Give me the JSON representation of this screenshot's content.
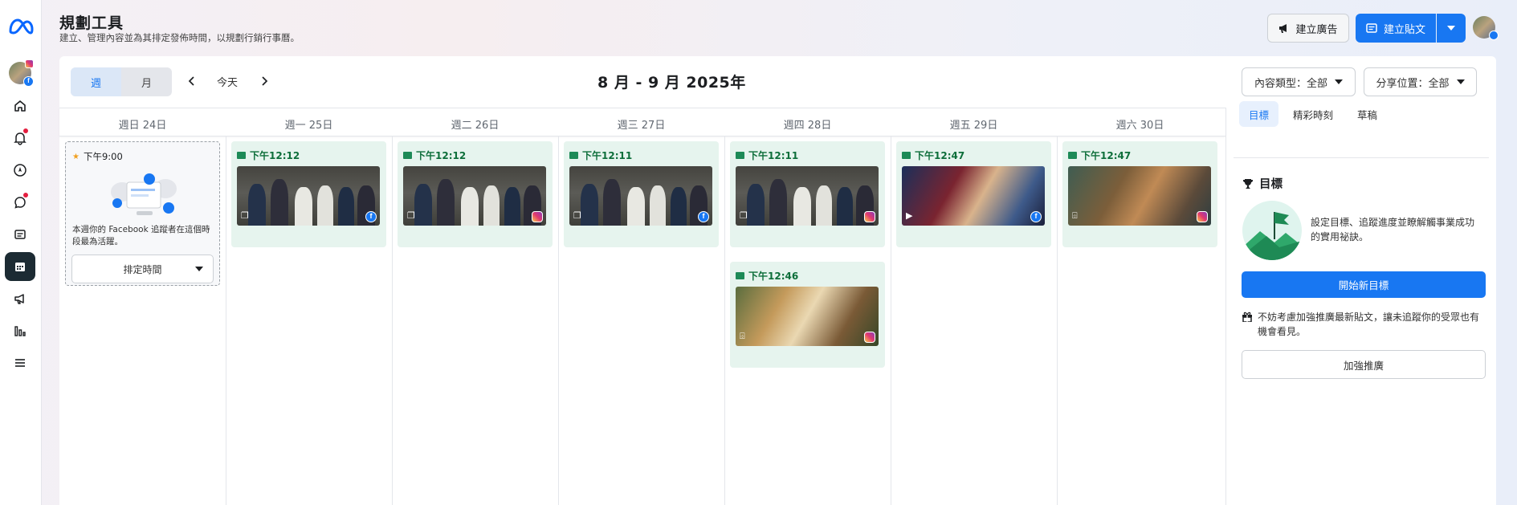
{
  "header": {
    "title": "規劃工具",
    "subtitle": "建立、管理內容並為其排定發佈時間，以規劃行銷行事曆。",
    "create_ad_label": "建立廣告",
    "create_post_label": "建立貼文"
  },
  "rail": {
    "items": [
      {
        "name": "home-icon"
      },
      {
        "name": "bell-icon"
      },
      {
        "name": "compass-icon"
      },
      {
        "name": "chat-icon"
      },
      {
        "name": "content-icon"
      },
      {
        "name": "calendar-icon"
      },
      {
        "name": "megaphone-icon"
      },
      {
        "name": "insights-icon"
      },
      {
        "name": "menu-icon"
      }
    ]
  },
  "toolbar": {
    "view_week": "週",
    "view_month": "月",
    "today": "今天",
    "date_range": "8 月 - 9 月 2025年",
    "filter_content_type": "內容類型：全部",
    "filter_share_location": "分享位置：全部"
  },
  "columns": [
    "週日 24日",
    "週一 25日",
    "週二 26日",
    "週三 27日",
    "週四 28日",
    "週五 29日",
    "週六 30日"
  ],
  "best_time": {
    "time": "下午9:00",
    "description": "本週你的 Facebook 追蹤者在這個時段最為活躍。",
    "schedule_label": "排定時間"
  },
  "posts": [
    {
      "day": 1,
      "time": "下午12:12",
      "thumb": "group",
      "type": "multi",
      "platform": "facebook"
    },
    {
      "day": 2,
      "time": "下午12:12",
      "thumb": "group",
      "type": "multi",
      "platform": "instagram"
    },
    {
      "day": 3,
      "time": "下午12:11",
      "thumb": "group",
      "type": "multi",
      "platform": "facebook"
    },
    {
      "day": 4,
      "time": "下午12:11",
      "thumb": "group",
      "type": "multi",
      "platform": "instagram"
    },
    {
      "day": 5,
      "time": "下午12:47",
      "thumb": "cartoon",
      "type": "video",
      "platform": "facebook"
    },
    {
      "day": 6,
      "time": "下午12:47",
      "thumb": "kids",
      "type": "reel",
      "platform": "instagram"
    },
    {
      "day": 4,
      "time": "下午12:46",
      "thumb": "food",
      "type": "reel",
      "platform": "instagram"
    }
  ],
  "sidebar": {
    "tabs": [
      "目標",
      "精彩時刻",
      "草稿"
    ],
    "goal_title": "目標",
    "goal_text": "設定目標、追蹤進度並瞭解觸事業成功的實用祕訣。",
    "new_goal_label": "開始新目標",
    "tip_text": "不妨考慮加強推廣最新貼文，讓未追蹤你的受眾也有機會看見。",
    "boost_label": "加強推廣"
  },
  "colors": {
    "accent": "#1877f2",
    "card_bg": "#e6f4ee",
    "time_text": "#0d6e3a",
    "rail_active": "#1c2b33"
  }
}
